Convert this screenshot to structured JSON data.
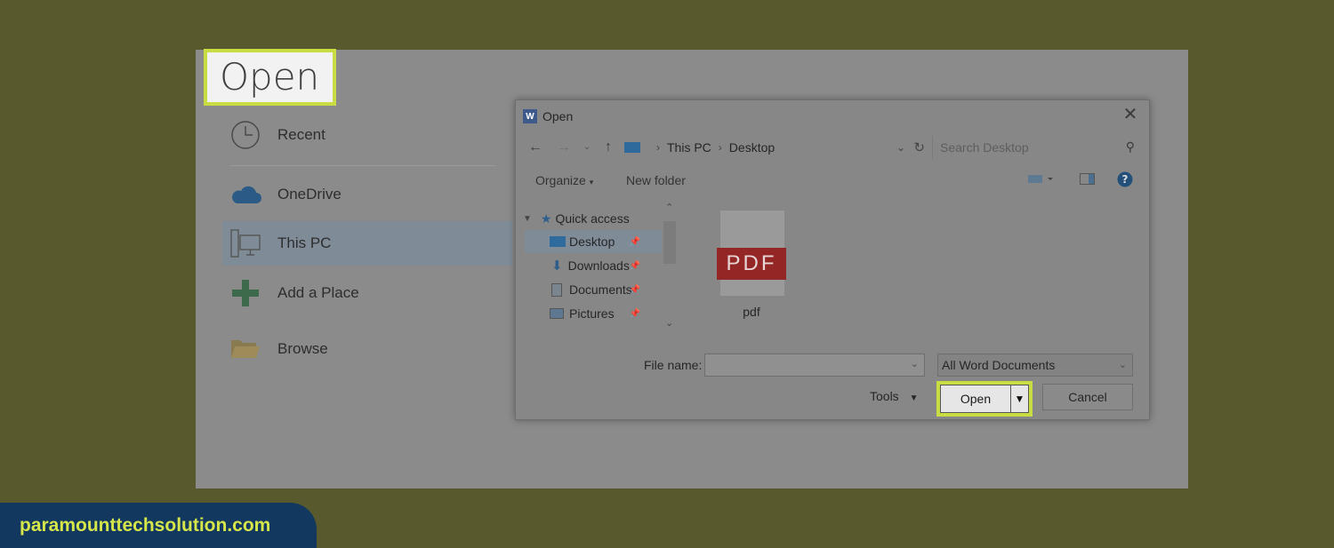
{
  "backstage": {
    "title": "Open",
    "nav": [
      {
        "label": "Recent",
        "icon": "clock-icon"
      },
      {
        "label": "OneDrive",
        "icon": "cloud-icon"
      },
      {
        "label": "This PC",
        "icon": "computer-icon",
        "selected": true
      },
      {
        "label": "Add a Place",
        "icon": "plus-icon"
      },
      {
        "label": "Browse",
        "icon": "folder-open-icon"
      }
    ]
  },
  "dialog": {
    "title": "Open",
    "path": [
      "This PC",
      "Desktop"
    ],
    "search_placeholder": "Search Desktop",
    "toolbar": {
      "organize": "Organize",
      "new_folder": "New folder"
    },
    "tree": [
      {
        "label": "Quick access",
        "icon": "star-icon"
      },
      {
        "label": "Desktop",
        "icon": "desktop-folder-icon",
        "selected": true
      },
      {
        "label": "Downloads",
        "icon": "download-icon"
      },
      {
        "label": "Documents",
        "icon": "documents-icon"
      },
      {
        "label": "Pictures",
        "icon": "pictures-icon"
      }
    ],
    "files": [
      {
        "name": "pdf",
        "badge": "PDF"
      }
    ],
    "file_name_label": "File name:",
    "file_name_value": "",
    "file_type": "All Word Documents",
    "tools_label": "Tools",
    "open_label": "Open",
    "cancel_label": "Cancel"
  },
  "brand": "paramounttechsolution.com",
  "colors": {
    "highlight": "#c9dc41",
    "background": "#58592c",
    "brand_bg": "#123860",
    "brand_text": "#d6e64a"
  }
}
